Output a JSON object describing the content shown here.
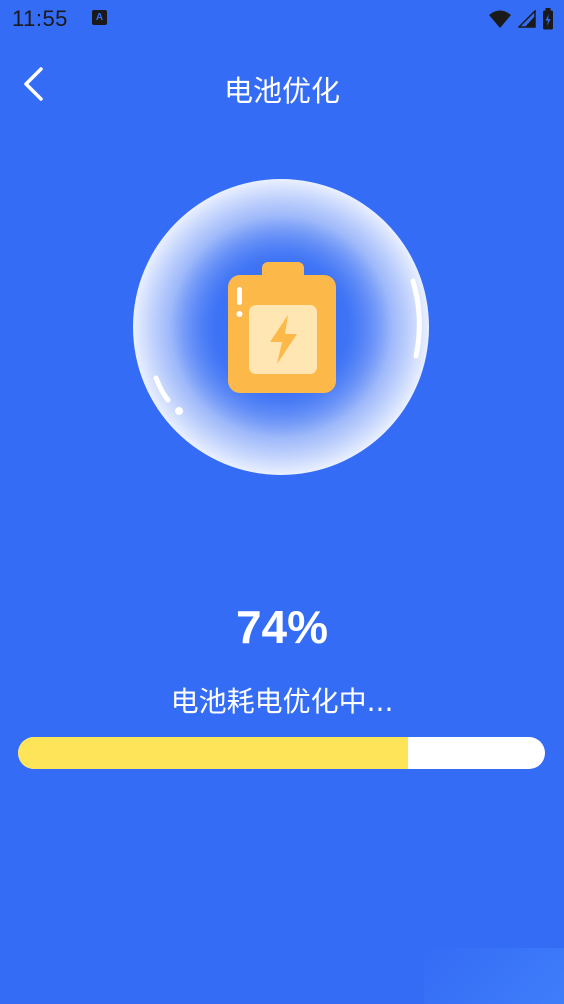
{
  "status_bar": {
    "time": "11:55",
    "notification_icon": "A",
    "icons": [
      "wifi-icon",
      "cell-signal-icon",
      "battery-charging-icon"
    ]
  },
  "header": {
    "back_icon": "chevron-left-icon",
    "title": "电池优化"
  },
  "illustration": {
    "icon": "battery-bolt-icon",
    "accent_color": "#fdb84a",
    "bubble_color": "#ffffff"
  },
  "progress": {
    "percent_label": "74%",
    "value": 0.74,
    "status_text": "电池耗电优化中...",
    "fill_color": "#fde459",
    "track_color": "#ffffff"
  },
  "theme": {
    "background": "#356cf5"
  }
}
